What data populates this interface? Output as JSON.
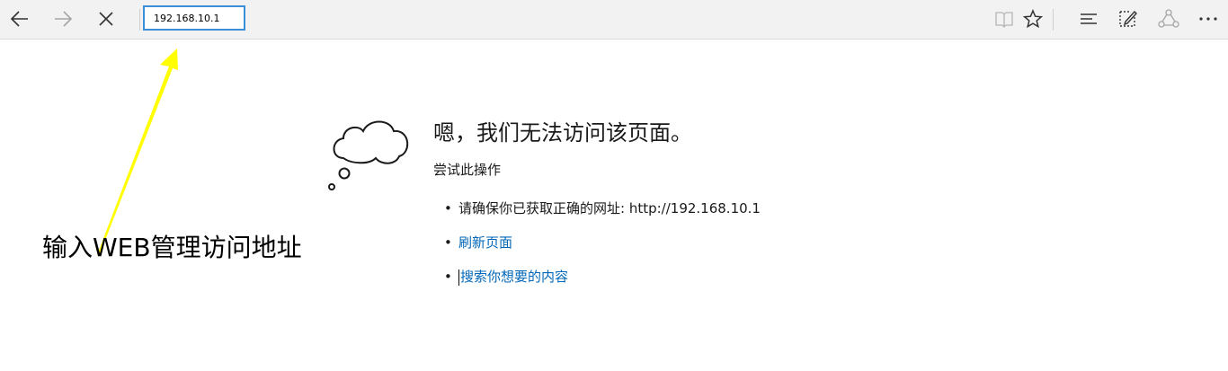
{
  "toolbar": {
    "address": "192.168.10.1",
    "icons": [
      "back-arrow-icon",
      "forward-arrow-icon",
      "close-icon",
      "reading-view-icon",
      "star-icon",
      "hub-icon",
      "web-note-icon",
      "share-icon",
      "more-icon"
    ]
  },
  "error": {
    "title": "嗯，我们无法访问该页面。",
    "subtitle": "尝试此操作",
    "suggestion_check_url": "请确保你已获取正确的网址: http://192.168.10.1",
    "suggestion_refresh": "刷新页面",
    "suggestion_search": "搜索你想要的内容",
    "bullet": "•"
  },
  "annotation": {
    "text": "输入WEB管理访问地址",
    "arrow_color": "#ffff00"
  },
  "colors": {
    "link": "#0067b8",
    "address_border": "#3b8fd9",
    "toolbar_bg": "#f2f2f2"
  }
}
